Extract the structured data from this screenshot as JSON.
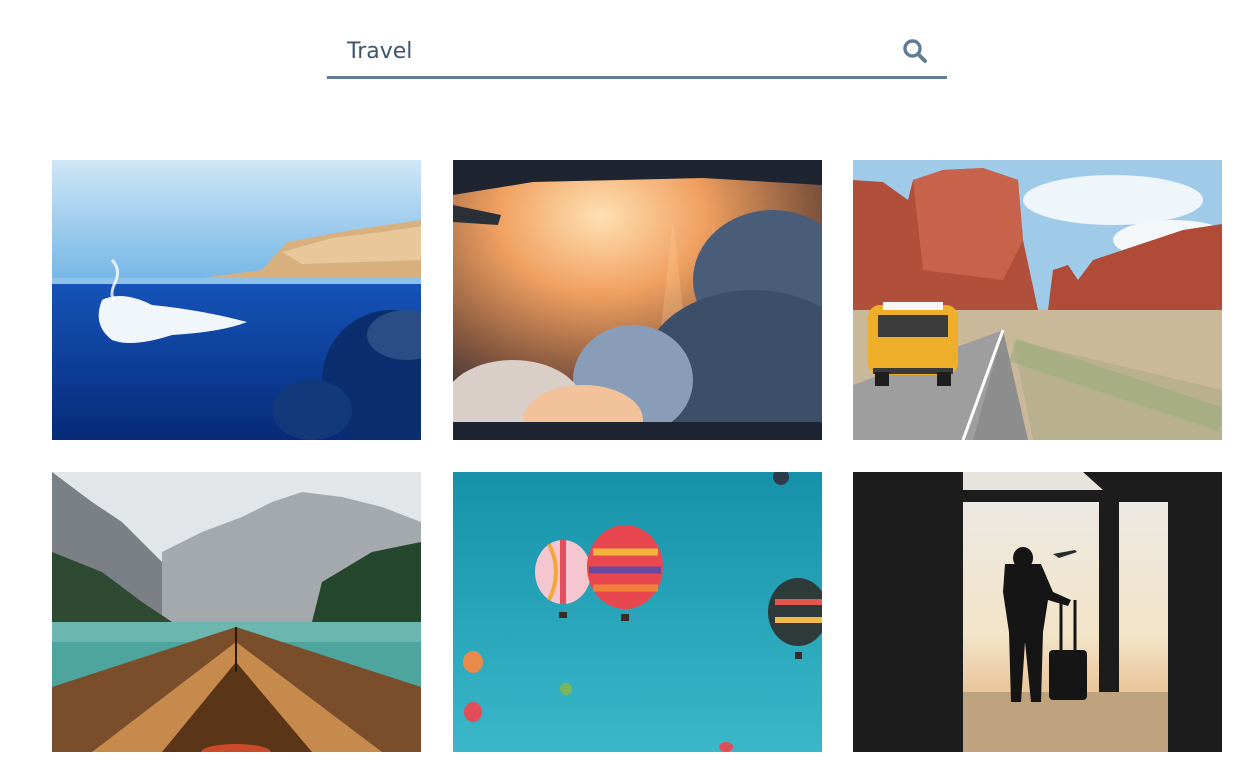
{
  "search": {
    "value": "Travel",
    "placeholder": "Search",
    "icon": "search-icon"
  },
  "gallery": {
    "images": [
      {
        "subject": "underwater-diver",
        "accent": "#0d3d9a"
      },
      {
        "subject": "clouds-from-airplane",
        "accent": "#e89a55"
      },
      {
        "subject": "yellow-van-desert-road",
        "accent": "#e8a51e"
      },
      {
        "subject": "boat-on-mountain-lake",
        "accent": "#3f9a95"
      },
      {
        "subject": "hot-air-balloons",
        "accent": "#1a9cb5"
      },
      {
        "subject": "traveler-silhouette-airport",
        "accent": "#1d1d1d"
      }
    ]
  },
  "colors": {
    "accent": "#607d94",
    "background": "#ffffff"
  }
}
